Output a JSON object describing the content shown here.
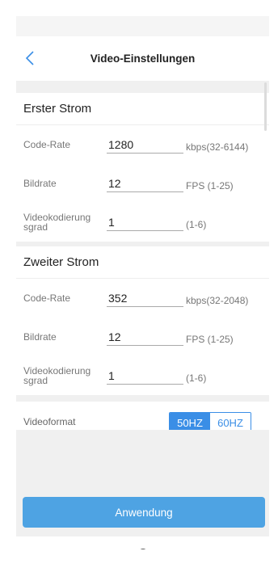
{
  "header": {
    "title": "Video-Einstellungen",
    "back_icon": "chevron-left-icon"
  },
  "first_stream": {
    "title": "Erster Strom",
    "code_rate": {
      "label": "Code-Rate",
      "value": "1280",
      "range": "kbps(32-6144)"
    },
    "frame_rate": {
      "label": "Bildrate",
      "value": "12",
      "range": "FPS (1-25)"
    },
    "encoding_level": {
      "label": "Videokodierung sgrad",
      "value": "1",
      "range": "(1-6)"
    }
  },
  "second_stream": {
    "title": "Zweiter Strom",
    "code_rate": {
      "label": "Code-Rate",
      "value": "352",
      "range": "kbps(32-2048)"
    },
    "frame_rate": {
      "label": "Bildrate",
      "value": "12",
      "range": "FPS (1-25)"
    },
    "encoding_level": {
      "label": "Videokodierung sgrad",
      "value": "1",
      "range": "(1-6)"
    }
  },
  "video_format": {
    "label": "Videoformat",
    "options": [
      "50HZ",
      "60HZ"
    ],
    "selected": "50HZ"
  },
  "apply_button": "Anwendung",
  "colors": {
    "accent": "#3a8ee6",
    "apply": "#4ea3e3",
    "background_gray": "#f0f0f0"
  },
  "navbar": {
    "icons": [
      "recent-apps-icon",
      "home-icon",
      "back-icon"
    ]
  }
}
